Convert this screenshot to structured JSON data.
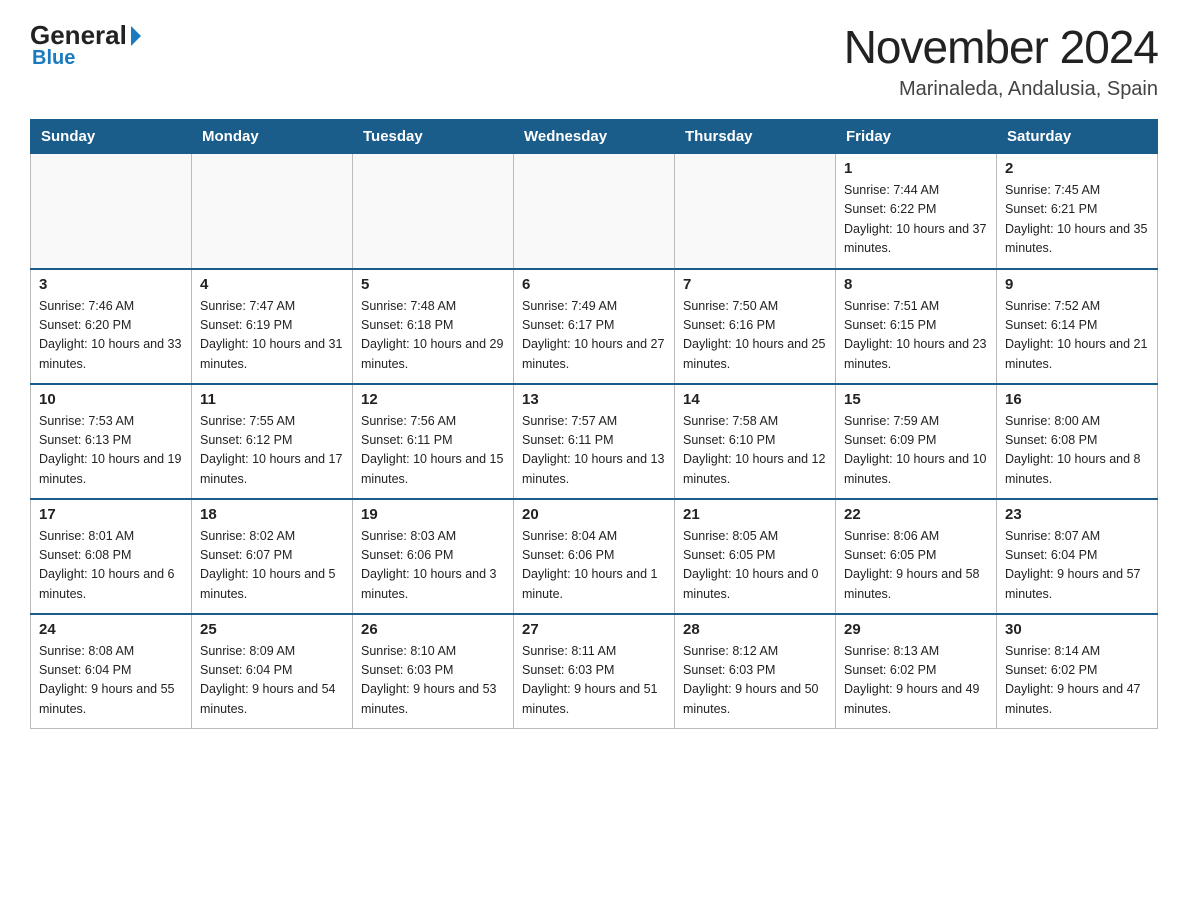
{
  "header": {
    "logo_general": "General",
    "logo_blue": "Blue",
    "month_title": "November 2024",
    "location": "Marinaleda, Andalusia, Spain"
  },
  "weekdays": [
    "Sunday",
    "Monday",
    "Tuesday",
    "Wednesday",
    "Thursday",
    "Friday",
    "Saturday"
  ],
  "weeks": [
    [
      {
        "day": "",
        "info": ""
      },
      {
        "day": "",
        "info": ""
      },
      {
        "day": "",
        "info": ""
      },
      {
        "day": "",
        "info": ""
      },
      {
        "day": "",
        "info": ""
      },
      {
        "day": "1",
        "info": "Sunrise: 7:44 AM\nSunset: 6:22 PM\nDaylight: 10 hours and 37 minutes."
      },
      {
        "day": "2",
        "info": "Sunrise: 7:45 AM\nSunset: 6:21 PM\nDaylight: 10 hours and 35 minutes."
      }
    ],
    [
      {
        "day": "3",
        "info": "Sunrise: 7:46 AM\nSunset: 6:20 PM\nDaylight: 10 hours and 33 minutes."
      },
      {
        "day": "4",
        "info": "Sunrise: 7:47 AM\nSunset: 6:19 PM\nDaylight: 10 hours and 31 minutes."
      },
      {
        "day": "5",
        "info": "Sunrise: 7:48 AM\nSunset: 6:18 PM\nDaylight: 10 hours and 29 minutes."
      },
      {
        "day": "6",
        "info": "Sunrise: 7:49 AM\nSunset: 6:17 PM\nDaylight: 10 hours and 27 minutes."
      },
      {
        "day": "7",
        "info": "Sunrise: 7:50 AM\nSunset: 6:16 PM\nDaylight: 10 hours and 25 minutes."
      },
      {
        "day": "8",
        "info": "Sunrise: 7:51 AM\nSunset: 6:15 PM\nDaylight: 10 hours and 23 minutes."
      },
      {
        "day": "9",
        "info": "Sunrise: 7:52 AM\nSunset: 6:14 PM\nDaylight: 10 hours and 21 minutes."
      }
    ],
    [
      {
        "day": "10",
        "info": "Sunrise: 7:53 AM\nSunset: 6:13 PM\nDaylight: 10 hours and 19 minutes."
      },
      {
        "day": "11",
        "info": "Sunrise: 7:55 AM\nSunset: 6:12 PM\nDaylight: 10 hours and 17 minutes."
      },
      {
        "day": "12",
        "info": "Sunrise: 7:56 AM\nSunset: 6:11 PM\nDaylight: 10 hours and 15 minutes."
      },
      {
        "day": "13",
        "info": "Sunrise: 7:57 AM\nSunset: 6:11 PM\nDaylight: 10 hours and 13 minutes."
      },
      {
        "day": "14",
        "info": "Sunrise: 7:58 AM\nSunset: 6:10 PM\nDaylight: 10 hours and 12 minutes."
      },
      {
        "day": "15",
        "info": "Sunrise: 7:59 AM\nSunset: 6:09 PM\nDaylight: 10 hours and 10 minutes."
      },
      {
        "day": "16",
        "info": "Sunrise: 8:00 AM\nSunset: 6:08 PM\nDaylight: 10 hours and 8 minutes."
      }
    ],
    [
      {
        "day": "17",
        "info": "Sunrise: 8:01 AM\nSunset: 6:08 PM\nDaylight: 10 hours and 6 minutes."
      },
      {
        "day": "18",
        "info": "Sunrise: 8:02 AM\nSunset: 6:07 PM\nDaylight: 10 hours and 5 minutes."
      },
      {
        "day": "19",
        "info": "Sunrise: 8:03 AM\nSunset: 6:06 PM\nDaylight: 10 hours and 3 minutes."
      },
      {
        "day": "20",
        "info": "Sunrise: 8:04 AM\nSunset: 6:06 PM\nDaylight: 10 hours and 1 minute."
      },
      {
        "day": "21",
        "info": "Sunrise: 8:05 AM\nSunset: 6:05 PM\nDaylight: 10 hours and 0 minutes."
      },
      {
        "day": "22",
        "info": "Sunrise: 8:06 AM\nSunset: 6:05 PM\nDaylight: 9 hours and 58 minutes."
      },
      {
        "day": "23",
        "info": "Sunrise: 8:07 AM\nSunset: 6:04 PM\nDaylight: 9 hours and 57 minutes."
      }
    ],
    [
      {
        "day": "24",
        "info": "Sunrise: 8:08 AM\nSunset: 6:04 PM\nDaylight: 9 hours and 55 minutes."
      },
      {
        "day": "25",
        "info": "Sunrise: 8:09 AM\nSunset: 6:04 PM\nDaylight: 9 hours and 54 minutes."
      },
      {
        "day": "26",
        "info": "Sunrise: 8:10 AM\nSunset: 6:03 PM\nDaylight: 9 hours and 53 minutes."
      },
      {
        "day": "27",
        "info": "Sunrise: 8:11 AM\nSunset: 6:03 PM\nDaylight: 9 hours and 51 minutes."
      },
      {
        "day": "28",
        "info": "Sunrise: 8:12 AM\nSunset: 6:03 PM\nDaylight: 9 hours and 50 minutes."
      },
      {
        "day": "29",
        "info": "Sunrise: 8:13 AM\nSunset: 6:02 PM\nDaylight: 9 hours and 49 minutes."
      },
      {
        "day": "30",
        "info": "Sunrise: 8:14 AM\nSunset: 6:02 PM\nDaylight: 9 hours and 47 minutes."
      }
    ]
  ],
  "accent_color": "#1a5c8a",
  "logo_color": "#1a7abf"
}
